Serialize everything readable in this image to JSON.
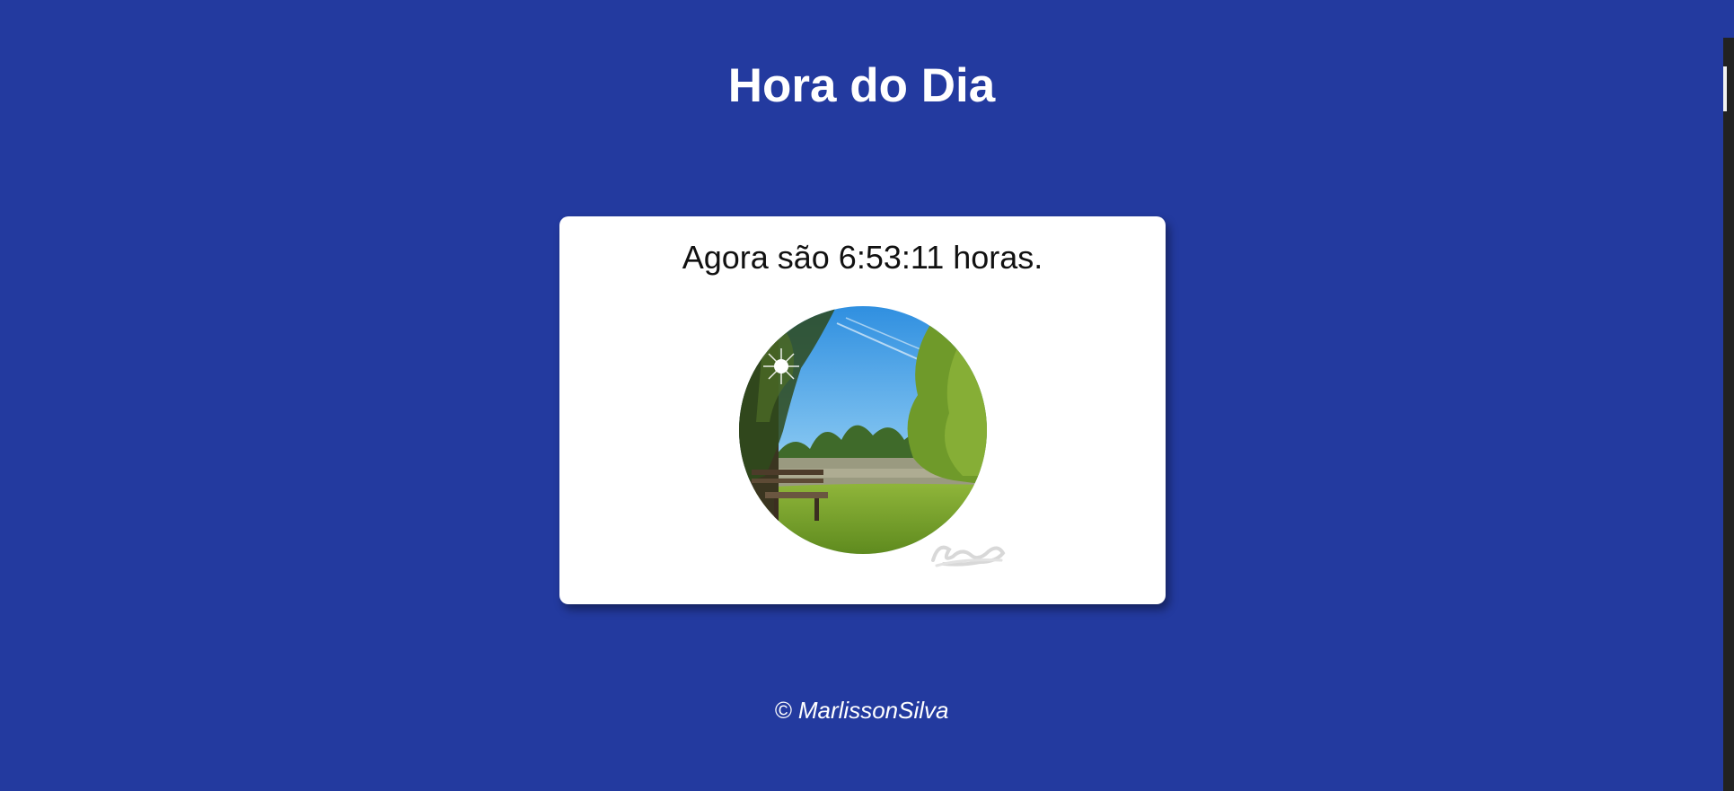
{
  "page": {
    "title": "Hora do Dia",
    "background_color": "#233a9f"
  },
  "card": {
    "message": "Agora são 6:53:11 horas.",
    "image_icon": "morning-park-lake-photo"
  },
  "footer": {
    "copyright": "© MarlissonSilva"
  }
}
